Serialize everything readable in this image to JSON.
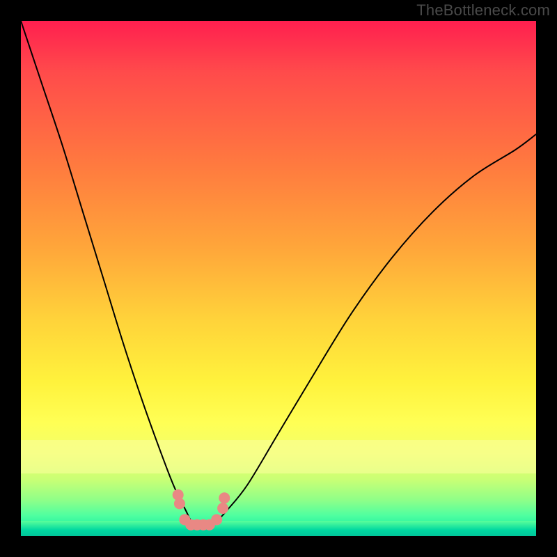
{
  "watermark": "TheBottleneck.com",
  "colors": {
    "curve_stroke": "#000000",
    "marker_fill": "#e98884",
    "marker_stroke": "#d36d68"
  },
  "chart_data": {
    "type": "line",
    "title": "",
    "xlabel": "",
    "ylabel": "",
    "xlim": [
      0,
      100
    ],
    "ylim": [
      0,
      100
    ],
    "x": [
      0,
      4,
      8,
      12,
      16,
      20,
      24,
      28,
      30,
      32,
      33,
      34,
      35,
      36,
      38,
      40,
      44,
      50,
      56,
      64,
      72,
      80,
      88,
      96,
      100
    ],
    "values": [
      100,
      88,
      76,
      63,
      50,
      37,
      25,
      14,
      9,
      5,
      3,
      2,
      2,
      2,
      3,
      5,
      10,
      20,
      30,
      43,
      54,
      63,
      70,
      75,
      78
    ],
    "minimum_x": 34,
    "markers": [
      {
        "x": 30.5,
        "y": 8.0
      },
      {
        "x": 30.8,
        "y": 6.3
      },
      {
        "x": 31.8,
        "y": 3.2
      },
      {
        "x": 33.0,
        "y": 2.2
      },
      {
        "x": 34.2,
        "y": 2.2
      },
      {
        "x": 35.4,
        "y": 2.2
      },
      {
        "x": 36.6,
        "y": 2.2
      },
      {
        "x": 38.0,
        "y": 3.2
      },
      {
        "x": 39.2,
        "y": 5.4
      },
      {
        "x": 39.5,
        "y": 7.4
      }
    ]
  }
}
